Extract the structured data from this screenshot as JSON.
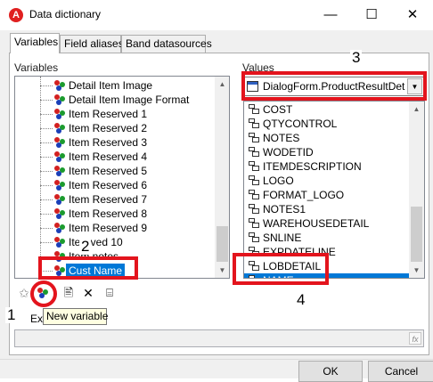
{
  "window": {
    "title": "Data dictionary",
    "controls": {
      "minimize": "—",
      "maximize": "☐",
      "close": "✕"
    }
  },
  "tabs": [
    {
      "label": "Variables",
      "active": true
    },
    {
      "label": "Field aliases",
      "active": false
    },
    {
      "label": "Band datasources",
      "active": false
    }
  ],
  "variables": {
    "label": "Variables",
    "items": [
      "Detail Item Image",
      "Detail Item Image Format",
      "Item Reserved 1",
      "Item Reserved 2",
      "Item Reserved 3",
      "Item Reserved 4",
      "Item Reserved 5",
      "Item Reserved 6",
      "Item Reserved 7",
      "Item Reserved 8",
      "Item Reserved 9",
      "Iter        rved 10",
      "Item notes",
      "Cust Name"
    ],
    "selected_index": 13
  },
  "values": {
    "label": "Values",
    "datasource": "DialogForm.ProductResultDet",
    "items": [
      "COST",
      "QTYCONTROL",
      "NOTES",
      "WODETID",
      "ITEMDESCRIPTION",
      "LOGO",
      "FORMAT_LOGO",
      "NOTES1",
      "WAREHOUSEDETAIL",
      "SNLINE",
      "EXPDATELINE",
      "LOBDETAIL",
      "NAME"
    ],
    "selected_index": 12
  },
  "toolbar": {
    "tooltip": "New variable",
    "delete_glyph": "✕"
  },
  "expression": {
    "label": "Ex",
    "value": "",
    "fx_label": "fx"
  },
  "buttons": {
    "ok": "OK",
    "cancel": "Cancel"
  },
  "annotations": {
    "n1": "1",
    "n2": "2",
    "n3": "3",
    "n4": "4"
  },
  "colors": {
    "annotation": "#e3141d",
    "selection": "#0078d7"
  }
}
